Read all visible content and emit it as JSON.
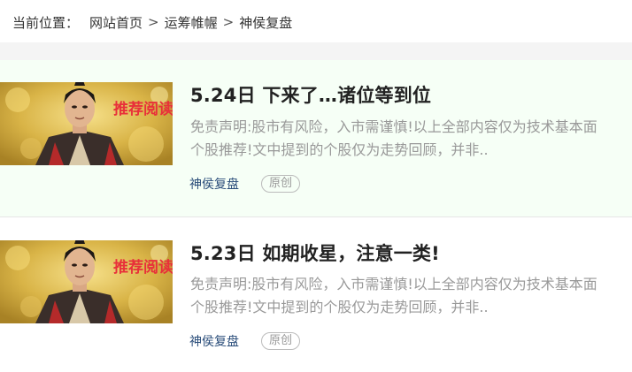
{
  "breadcrumb": {
    "prefix": "当前位置：",
    "items": [
      "网站首页",
      "运筹帷幄",
      "神侯复盘"
    ],
    "separator": ">"
  },
  "articles": [
    {
      "title": "5.24日 下来了…诸位等到位",
      "summary_line1": "免责声明:股市有风险，入市需谨慎!以上全部内容仅为技术基本面",
      "summary_line2": "个股推荐!文中提到的个股仅为走势回顾，并非..",
      "category": "神侯复盘",
      "badge": "原创",
      "thumb_text": "推荐阅读"
    },
    {
      "title": "5.23日 如期收星，注意一类!",
      "summary_line1": "免责声明:股市有风险，入市需谨慎!以上全部内容仅为技术基本面",
      "summary_line2": "个股推荐!文中提到的个股仅为走势回顾，并非..",
      "category": "神侯复盘",
      "badge": "原创",
      "thumb_text": "推荐阅读"
    }
  ],
  "colors": {
    "list_highlight_bg": "#f6fff6",
    "category_link": "#2a4d7a",
    "summary_text": "#999999",
    "thumb_text": "#e8303a"
  }
}
